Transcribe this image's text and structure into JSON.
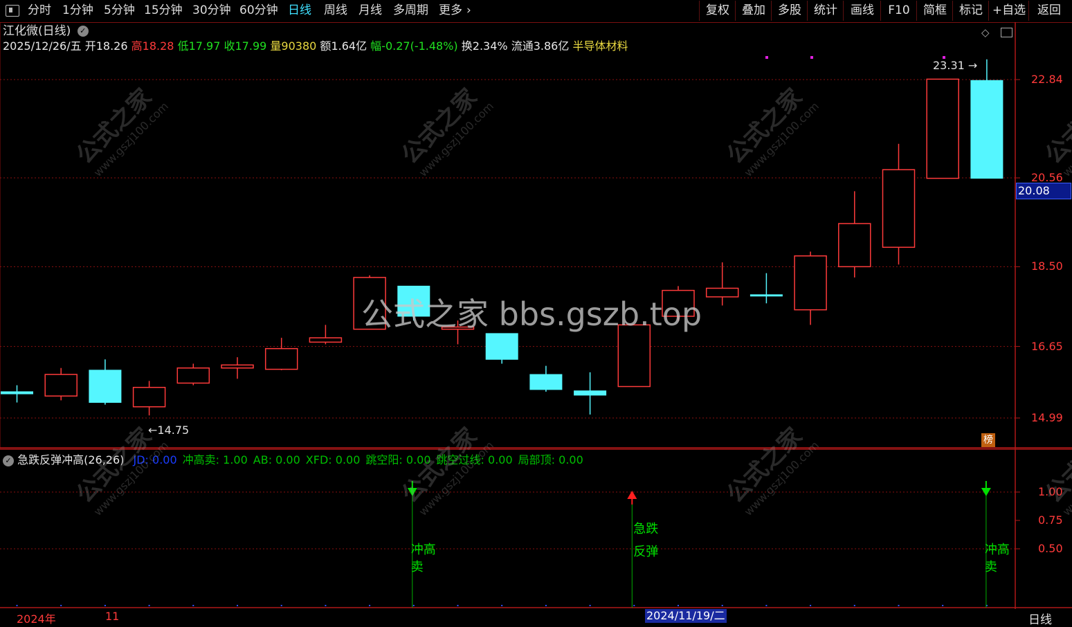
{
  "toolbar": {
    "periods": [
      {
        "label": "分时",
        "active": false
      },
      {
        "label": "1分钟",
        "active": false
      },
      {
        "label": "5分钟",
        "active": false
      },
      {
        "label": "15分钟",
        "active": false
      },
      {
        "label": "30分钟",
        "active": false
      },
      {
        "label": "60分钟",
        "active": false
      },
      {
        "label": "日线",
        "active": true
      },
      {
        "label": "周线",
        "active": false
      },
      {
        "label": "月线",
        "active": false
      },
      {
        "label": "多周期",
        "active": false
      },
      {
        "label": "更多",
        "active": false
      }
    ],
    "more_arrow": "›",
    "buttons": [
      "复权",
      "叠加",
      "多股",
      "统计",
      "画线",
      "F10",
      "简框",
      "标记",
      "+自选",
      "返回"
    ]
  },
  "stock": {
    "title": "江化微(日线)",
    "date": "2025/12/26/五",
    "open_label": "开",
    "open": "18.26",
    "high_label": "高",
    "high": "18.28",
    "low_label": "低",
    "low": "17.97",
    "close_label": "收",
    "close": "17.99",
    "volume_label": "量",
    "volume": "90380",
    "amount_label": "额",
    "amount": "1.64亿",
    "change_label": "幅",
    "change": "-0.27(-1.48%)",
    "turnover_label": "换",
    "turnover": "2.34%",
    "float_label": "流通",
    "float": "3.86亿",
    "sector": "半导体材料"
  },
  "main_axis": {
    "labels": [
      "22.84",
      "20.56",
      "18.50",
      "16.65",
      "14.99"
    ],
    "current_price": "20.08"
  },
  "annotations": {
    "high_mark": "23.31",
    "low_mark": "14.75",
    "badge": "榜"
  },
  "candles": [
    {
      "o": 15.6,
      "c": 15.55,
      "h": 15.75,
      "l": 15.35,
      "color": "cyan"
    },
    {
      "o": 15.5,
      "c": 16.0,
      "h": 16.15,
      "l": 15.4,
      "color": "red"
    },
    {
      "o": 16.1,
      "c": 15.35,
      "h": 16.35,
      "l": 15.3,
      "color": "cyan"
    },
    {
      "o": 15.25,
      "c": 15.7,
      "h": 15.85,
      "l": 15.05,
      "color": "red"
    },
    {
      "o": 15.8,
      "c": 16.15,
      "h": 16.25,
      "l": 15.75,
      "color": "red"
    },
    {
      "o": 16.15,
      "c": 16.22,
      "h": 16.4,
      "l": 15.9,
      "color": "red"
    },
    {
      "o": 16.12,
      "c": 16.6,
      "h": 16.85,
      "l": 16.1,
      "color": "red"
    },
    {
      "o": 16.75,
      "c": 16.85,
      "h": 17.15,
      "l": 16.7,
      "color": "red"
    },
    {
      "o": 17.05,
      "c": 18.25,
      "h": 18.3,
      "l": 17.05,
      "color": "red"
    },
    {
      "o": 18.05,
      "c": 17.35,
      "h": 18.05,
      "l": 17.25,
      "color": "cyan"
    },
    {
      "o": 17.05,
      "c": 17.1,
      "h": 17.25,
      "l": 16.7,
      "color": "red"
    },
    {
      "o": 16.95,
      "c": 16.35,
      "h": 16.95,
      "l": 16.25,
      "color": "cyan"
    },
    {
      "o": 16.0,
      "c": 15.65,
      "h": 16.2,
      "l": 15.6,
      "color": "cyan"
    },
    {
      "o": 15.62,
      "c": 15.52,
      "h": 16.05,
      "l": 15.07,
      "color": "cyan"
    },
    {
      "o": 15.72,
      "c": 17.15,
      "h": 17.15,
      "l": 15.72,
      "color": "red"
    },
    {
      "o": 17.35,
      "c": 17.95,
      "h": 18.05,
      "l": 17.25,
      "color": "red"
    },
    {
      "o": 17.8,
      "c": 18.0,
      "h": 18.6,
      "l": 17.6,
      "color": "red"
    },
    {
      "o": 17.85,
      "c": 17.85,
      "h": 18.35,
      "l": 17.65,
      "color": "cyan"
    },
    {
      "o": 17.5,
      "c": 18.75,
      "h": 18.85,
      "l": 17.15,
      "color": "red"
    },
    {
      "o": 18.5,
      "c": 19.5,
      "h": 20.25,
      "l": 18.25,
      "color": "red"
    },
    {
      "o": 18.95,
      "c": 20.75,
      "h": 21.35,
      "l": 18.55,
      "color": "red"
    },
    {
      "o": 20.55,
      "c": 22.85,
      "h": 22.85,
      "l": 20.55,
      "color": "red"
    },
    {
      "o": 22.82,
      "c": 20.55,
      "h": 23.31,
      "l": 20.55,
      "color": "cyan"
    }
  ],
  "indicator": {
    "name": "急跌反弹冲高(26,26)",
    "params": [
      {
        "label": "JD:",
        "value": "0.00",
        "color": "#1a3cff"
      },
      {
        "label": "冲高卖:",
        "value": "1.00",
        "color": "#00c000"
      },
      {
        "label": "AB:",
        "value": "0.00",
        "color": "#00c000"
      },
      {
        "label": "XFD:",
        "value": "0.00",
        "color": "#00c000"
      },
      {
        "label": "跳空阳:",
        "value": "0.00",
        "color": "#00c000"
      },
      {
        "label": "跳空过线:",
        "value": "0.00",
        "color": "#00c000"
      },
      {
        "label": "局部顶:",
        "value": "0.00",
        "color": "#00c000"
      }
    ],
    "axis_labels": [
      "1.00",
      "0.75",
      "0.50"
    ],
    "signals": [
      {
        "index": 9,
        "type": "sell",
        "text": "冲高卖"
      },
      {
        "index": 14,
        "type": "buy",
        "text": "急跌反弹"
      },
      {
        "index": 22,
        "type": "sell",
        "text": "冲高卖"
      }
    ]
  },
  "bottom": {
    "year_label": "2024年",
    "month_label": "11",
    "date_label": "2024/11/19/二",
    "period_label": "日线"
  },
  "watermark": {
    "center": "公式之家 bbs.gszb.top",
    "brand": "公式之家",
    "url": "www.gszj100.com"
  },
  "colors": {
    "up": "#ff3b3b",
    "down": "#55f6ff",
    "grid": "#8a1010",
    "active": "#3fe0ff",
    "signal_green": "#00e000",
    "signal_red": "#ff2020"
  }
}
